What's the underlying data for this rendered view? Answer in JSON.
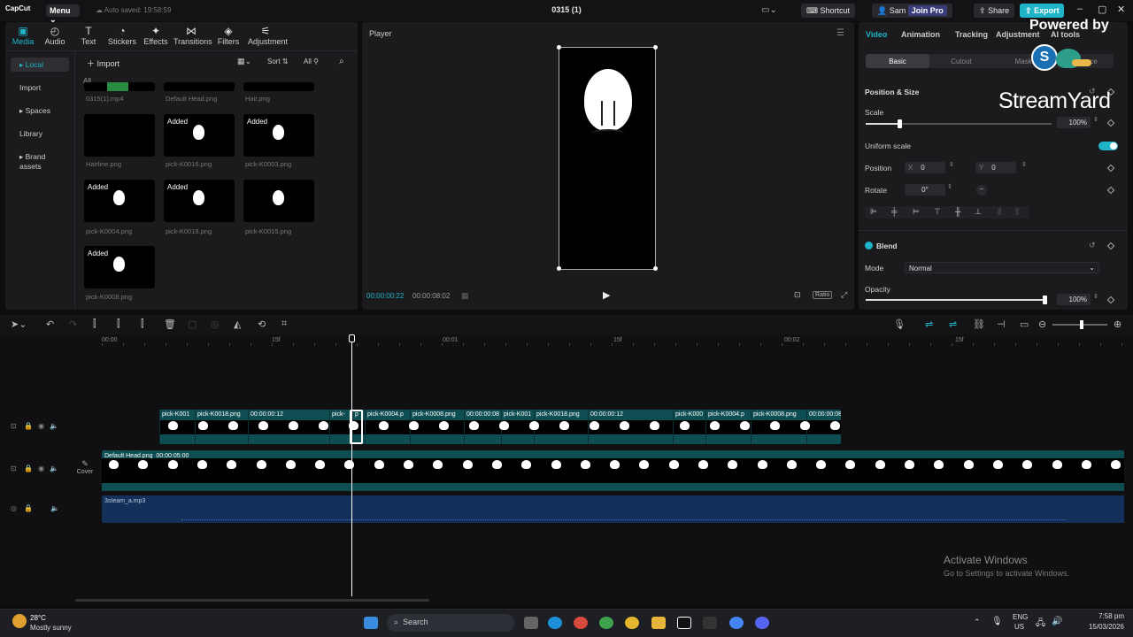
{
  "titlebar": {
    "app_name": "CapCut",
    "menu_label": "Menu",
    "autosave_text": "Auto saved: 19:58:59",
    "project_title": "0315 (1)",
    "shortcut_label": "Shortcut",
    "user_name": "Sam",
    "join_pro_label": "Join Pro",
    "share_label": "Share",
    "export_label": "Export"
  },
  "media_tools": [
    {
      "label": "Media",
      "icon": "media-icon",
      "active": true
    },
    {
      "label": "Audio",
      "icon": "audio-icon"
    },
    {
      "label": "Text",
      "icon": "text-icon"
    },
    {
      "label": "Stickers",
      "icon": "sticker-icon"
    },
    {
      "label": "Effects",
      "icon": "effects-icon"
    },
    {
      "label": "Transitions",
      "icon": "transitions-icon"
    },
    {
      "label": "Filters",
      "icon": "filters-icon"
    },
    {
      "label": "Adjustment",
      "icon": "adjustment-icon"
    }
  ],
  "media_sidebar": [
    "Local",
    "Import",
    "Spaces",
    "Library",
    "Brand assets"
  ],
  "media_header": {
    "import_label": "Import",
    "sort_label": "Sort",
    "all_label": "All",
    "filter_all": "All"
  },
  "media_items": [
    {
      "name": "0315(1).mp4",
      "added": ""
    },
    {
      "name": "Default Head.png",
      "added": ""
    },
    {
      "name": "Hair.png",
      "added": ""
    },
    {
      "name": "Hairline.png",
      "added": ""
    },
    {
      "name": "pick-K0016.png",
      "added": "Added"
    },
    {
      "name": "pick-K0003.png",
      "added": "Added"
    },
    {
      "name": "pick-K0004.png",
      "added": "Added"
    },
    {
      "name": "pick-K0018.png",
      "added": "Added"
    },
    {
      "name": "pick-K0015.png",
      "added": ""
    },
    {
      "name": "pick-K0008.png",
      "added": "Added"
    }
  ],
  "player": {
    "title": "Player",
    "current_time": "00:00:00:22",
    "total_time": "00:00:08:02",
    "ratio_label": "Ratio"
  },
  "properties": {
    "tabs": [
      "Video",
      "Animation",
      "Tracking",
      "Adjustment",
      "AI tools"
    ],
    "subtabs": [
      "Basic",
      "Cutout",
      "Mask",
      "Enhance"
    ],
    "section_position": "Position & Size",
    "scale_label": "Scale",
    "scale_value": "100%",
    "scale_level": 0.18,
    "uniform_scale_label": "Uniform scale",
    "position_label": "Position",
    "pos_x_label": "X",
    "pos_x": "0",
    "pos_y_label": "Y",
    "pos_y": "0",
    "rotate_label": "Rotate",
    "rotate_value": "0°",
    "section_blend": "Blend",
    "mode_label": "Mode",
    "mode_value": "Normal",
    "opacity_label": "Opacity",
    "opacity_value": "100%",
    "opacity_level": 1.0
  },
  "overlay": {
    "powered_by": "Powered by",
    "brand": "StreamYard"
  },
  "ruler": [
    "00:00",
    "15f",
    "00:01",
    "15f",
    "00:02",
    "15f"
  ],
  "tracks": {
    "overlay_clips": [
      {
        "label": "pick-K001"
      },
      {
        "label": "pick-K0018.png"
      },
      {
        "label": "00:00:00:12"
      },
      {
        "label": "pick-"
      },
      {
        "label": "p"
      },
      {
        "label": "pick-K0004.p"
      },
      {
        "label": "pick-K0008.png"
      },
      {
        "label": "00:00:00:08"
      },
      {
        "label": "pick-K001"
      },
      {
        "label": "pick-K0018.png"
      },
      {
        "label": "00:00:00:12"
      },
      {
        "label": "pick-K000"
      },
      {
        "label": "pick-K0004.p"
      },
      {
        "label": "pick-K0008.png"
      },
      {
        "label": "00:00:00:08"
      }
    ],
    "main_clip_label": "Default Head.png",
    "main_clip_duration": "00:00:05:00",
    "cover_label": "Cover",
    "audio_clip_label": "3steam_a.mp3"
  },
  "watermark": {
    "title": "Activate Windows",
    "subtitle": "Go to Settings to activate Windows."
  },
  "taskbar": {
    "weather_temp": "28°C",
    "weather_desc": "Mostly sunny",
    "search_label": "Search",
    "lang": "ENG",
    "region": "US",
    "time": "7:58 pm",
    "date": "15/03/2026"
  },
  "colors": {
    "accent": "#1fb4c8",
    "clip": "#0e4d52",
    "audio": "#14305a"
  }
}
